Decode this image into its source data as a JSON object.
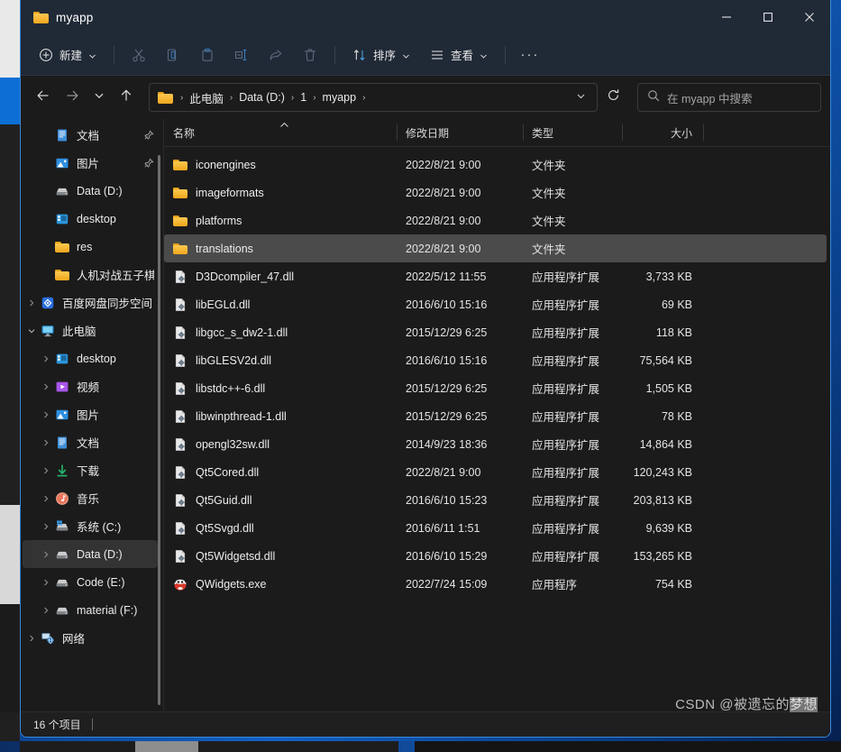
{
  "window": {
    "title": "myapp",
    "title_icon": "folder-icon",
    "controls": {
      "minimize": "minimize-icon",
      "maximize": "maximize-icon",
      "close": "close-icon"
    }
  },
  "toolbar": {
    "new_label": "新建",
    "new_icon": "plus-circle-icon",
    "cut_icon": "scissors-icon",
    "copy_icon": "copy-icon",
    "paste_icon": "clipboard-icon",
    "rename_icon": "rename-icon",
    "share_icon": "share-icon",
    "delete_icon": "trash-icon",
    "sort_label": "排序",
    "sort_icon": "sort-arrows-icon",
    "view_label": "查看",
    "view_icon": "list-lines-icon",
    "more_label": "···"
  },
  "address": {
    "back_icon": "arrow-left-icon",
    "forward_icon": "arrow-right-icon",
    "recent_icon": "chevron-down-icon",
    "up_icon": "arrow-up-icon",
    "folder_icon": "folder-icon",
    "crumbs": [
      "此电脑",
      "Data (D:)",
      "1",
      "myapp"
    ],
    "separator": "›",
    "dropdown_icon": "chevron-down-icon",
    "refresh_icon": "refresh-icon"
  },
  "search": {
    "icon": "search-icon",
    "placeholder": "在 myapp 中搜索"
  },
  "sidebar": {
    "scroll_thumb": true,
    "items": [
      {
        "label": "文档",
        "icon": "documents-icon",
        "indent": 1,
        "expander": false,
        "pinned": true,
        "selected": false
      },
      {
        "label": "图片",
        "icon": "pictures-icon",
        "indent": 1,
        "expander": false,
        "pinned": true,
        "selected": false
      },
      {
        "label": "Data (D:)",
        "icon": "drive-icon",
        "indent": 1,
        "expander": false,
        "pinned": false,
        "selected": false
      },
      {
        "label": "desktop",
        "icon": "desktop-icon",
        "indent": 1,
        "expander": false,
        "pinned": false,
        "selected": false
      },
      {
        "label": "res",
        "icon": "folder-icon",
        "indent": 1,
        "expander": false,
        "pinned": false,
        "selected": false
      },
      {
        "label": "人机对战五子棋",
        "icon": "folder-icon",
        "indent": 1,
        "expander": false,
        "pinned": false,
        "selected": false
      },
      {
        "label": "百度网盘同步空间",
        "icon": "baidu-icon",
        "indent": 0,
        "expander": true,
        "pinned": false,
        "selected": false
      },
      {
        "label": "此电脑",
        "icon": "thispc-icon",
        "indent": 0,
        "expander": "open",
        "pinned": false,
        "selected": false
      },
      {
        "label": "desktop",
        "icon": "desktop-icon",
        "indent": 1,
        "expander": true,
        "pinned": false,
        "selected": false
      },
      {
        "label": "视频",
        "icon": "videos-icon",
        "indent": 1,
        "expander": true,
        "pinned": false,
        "selected": false
      },
      {
        "label": "图片",
        "icon": "pictures-icon",
        "indent": 1,
        "expander": true,
        "pinned": false,
        "selected": false
      },
      {
        "label": "文档",
        "icon": "documents-icon",
        "indent": 1,
        "expander": true,
        "pinned": false,
        "selected": false
      },
      {
        "label": "下载",
        "icon": "downloads-icon",
        "indent": 1,
        "expander": true,
        "pinned": false,
        "selected": false
      },
      {
        "label": "音乐",
        "icon": "music-icon",
        "indent": 1,
        "expander": true,
        "pinned": false,
        "selected": false
      },
      {
        "label": "系统 (C:)",
        "icon": "windrive-icon",
        "indent": 1,
        "expander": true,
        "pinned": false,
        "selected": false
      },
      {
        "label": "Data (D:)",
        "icon": "drive-icon",
        "indent": 1,
        "expander": true,
        "pinned": false,
        "selected": true
      },
      {
        "label": "Code (E:)",
        "icon": "drive-icon",
        "indent": 1,
        "expander": true,
        "pinned": false,
        "selected": false
      },
      {
        "label": "material (F:)",
        "icon": "drive-icon",
        "indent": 1,
        "expander": true,
        "pinned": false,
        "selected": false
      },
      {
        "label": "网络",
        "icon": "network-icon",
        "indent": 0,
        "expander": true,
        "pinned": false,
        "selected": false
      }
    ]
  },
  "filelist": {
    "columns": [
      "名称",
      "修改日期",
      "类型",
      "大小"
    ],
    "sort_column": "名称",
    "sort_direction": "asc",
    "rows": [
      {
        "name": "iconengines",
        "date": "2022/8/21 9:00",
        "type": "文件夹",
        "size": "",
        "icon": "folder-icon",
        "selected": false
      },
      {
        "name": "imageformats",
        "date": "2022/8/21 9:00",
        "type": "文件夹",
        "size": "",
        "icon": "folder-icon",
        "selected": false
      },
      {
        "name": "platforms",
        "date": "2022/8/21 9:00",
        "type": "文件夹",
        "size": "",
        "icon": "folder-icon",
        "selected": false
      },
      {
        "name": "translations",
        "date": "2022/8/21 9:00",
        "type": "文件夹",
        "size": "",
        "icon": "folder-icon",
        "selected": true
      },
      {
        "name": "D3Dcompiler_47.dll",
        "date": "2022/5/12 11:55",
        "type": "应用程序扩展",
        "size": "3,733 KB",
        "icon": "dll-icon",
        "selected": false
      },
      {
        "name": "libEGLd.dll",
        "date": "2016/6/10 15:16",
        "type": "应用程序扩展",
        "size": "69 KB",
        "icon": "dll-icon",
        "selected": false
      },
      {
        "name": "libgcc_s_dw2-1.dll",
        "date": "2015/12/29 6:25",
        "type": "应用程序扩展",
        "size": "118 KB",
        "icon": "dll-icon",
        "selected": false
      },
      {
        "name": "libGLESV2d.dll",
        "date": "2016/6/10 15:16",
        "type": "应用程序扩展",
        "size": "75,564 KB",
        "icon": "dll-icon",
        "selected": false
      },
      {
        "name": "libstdc++-6.dll",
        "date": "2015/12/29 6:25",
        "type": "应用程序扩展",
        "size": "1,505 KB",
        "icon": "dll-icon",
        "selected": false
      },
      {
        "name": "libwinpthread-1.dll",
        "date": "2015/12/29 6:25",
        "type": "应用程序扩展",
        "size": "78 KB",
        "icon": "dll-icon",
        "selected": false
      },
      {
        "name": "opengl32sw.dll",
        "date": "2014/9/23 18:36",
        "type": "应用程序扩展",
        "size": "14,864 KB",
        "icon": "dll-icon",
        "selected": false
      },
      {
        "name": "Qt5Cored.dll",
        "date": "2022/8/21 9:00",
        "type": "应用程序扩展",
        "size": "120,243 KB",
        "icon": "dll-icon",
        "selected": false
      },
      {
        "name": "Qt5Guid.dll",
        "date": "2016/6/10 15:23",
        "type": "应用程序扩展",
        "size": "203,813 KB",
        "icon": "dll-icon",
        "selected": false
      },
      {
        "name": "Qt5Svgd.dll",
        "date": "2016/6/11 1:51",
        "type": "应用程序扩展",
        "size": "9,639 KB",
        "icon": "dll-icon",
        "selected": false
      },
      {
        "name": "Qt5Widgetsd.dll",
        "date": "2016/6/10 15:29",
        "type": "应用程序扩展",
        "size": "153,265 KB",
        "icon": "dll-icon",
        "selected": false
      },
      {
        "name": "QWidgets.exe",
        "date": "2022/7/24 15:09",
        "type": "应用程序",
        "size": "754 KB",
        "icon": "qt-app-icon",
        "selected": false
      }
    ]
  },
  "statusbar": {
    "item_count": "16 个项目"
  },
  "watermark": {
    "prefix": "CSDN @被遗忘的",
    "highlight": "梦想"
  },
  "colors": {
    "window_bg": "#1b1b1b",
    "titlebar_bg": "#202936",
    "accent_border": "#3a88d8",
    "selected_row": "#4b4b4b",
    "folder_yellow": "#f0a81f",
    "desktop_blue": "#0d58b8"
  }
}
